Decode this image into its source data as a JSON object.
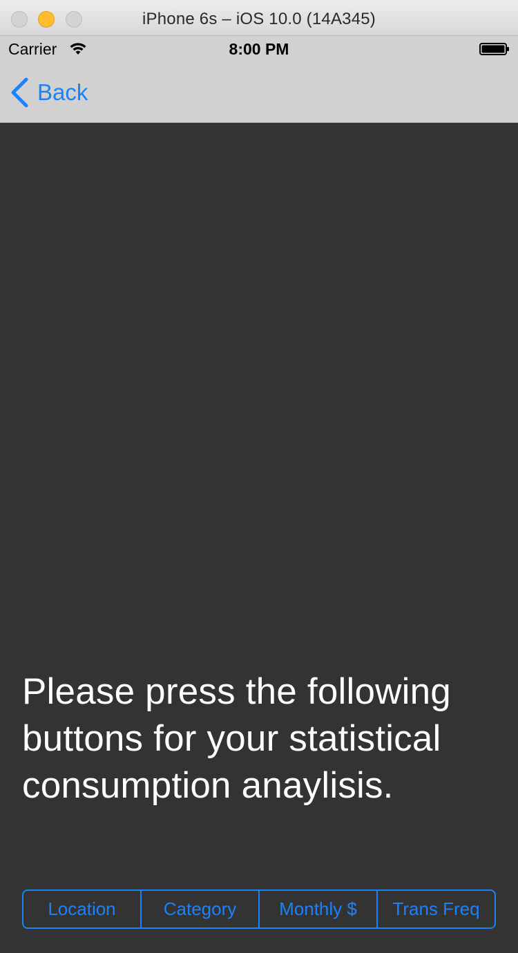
{
  "window": {
    "title": "iPhone 6s – iOS 10.0 (14A345)"
  },
  "status_bar": {
    "carrier": "Carrier",
    "time": "8:00 PM",
    "wifi_icon": "wifi-icon",
    "battery_icon": "battery-icon",
    "battery_level": 1.0
  },
  "nav_bar": {
    "back_label": "Back",
    "back_icon": "chevron-left-icon"
  },
  "main": {
    "message": "Please press the following buttons for your statistical consumption anaylisis."
  },
  "segmented_control": {
    "items": [
      {
        "label": "Location"
      },
      {
        "label": "Category"
      },
      {
        "label": "Monthly $"
      },
      {
        "label": "Trans Freq"
      }
    ]
  },
  "colors": {
    "accent": "#1a82fb",
    "background": "#333333",
    "bar_background": "#d1d1d1",
    "text_light": "#ffffff"
  }
}
